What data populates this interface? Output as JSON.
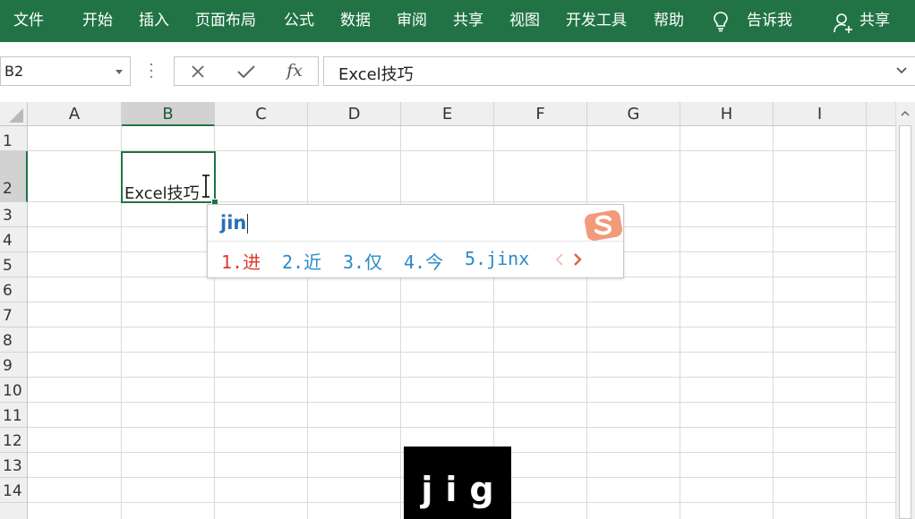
{
  "ribbon": {
    "tabs": [
      {
        "id": "file",
        "label": "文件"
      },
      {
        "id": "home",
        "label": "开始"
      },
      {
        "id": "insert",
        "label": "插入"
      },
      {
        "id": "page-layout",
        "label": "页面布局"
      },
      {
        "id": "formulas",
        "label": "公式"
      },
      {
        "id": "data",
        "label": "数据"
      },
      {
        "id": "review",
        "label": "审阅"
      },
      {
        "id": "share-tab",
        "label": "共享"
      },
      {
        "id": "view",
        "label": "视图"
      },
      {
        "id": "developer",
        "label": "开发工具"
      },
      {
        "id": "help",
        "label": "帮助"
      }
    ],
    "tell_me": "告诉我",
    "share": "共享",
    "background": "#217346"
  },
  "formula_bar": {
    "name_box": "B2",
    "cancel_icon": "x-icon",
    "enter_icon": "check-icon",
    "fx_label": "fx",
    "formula_value": "Excel技巧"
  },
  "grid": {
    "columns": [
      "A",
      "B",
      "C",
      "D",
      "E",
      "F",
      "G",
      "H",
      "I"
    ],
    "rows": [
      "1",
      "2",
      "3",
      "4",
      "5",
      "6",
      "7",
      "8",
      "9",
      "10",
      "11",
      "12",
      "13",
      "14"
    ],
    "selected_column": "B",
    "selected_row": "2",
    "active_cell_text": "Excel技巧",
    "accent": "#217346"
  },
  "ime": {
    "composition": "jin",
    "candidates": [
      "1.进",
      "2.近",
      "3.仅",
      "4.今",
      "5.jinx"
    ],
    "first_color": "#e0392b",
    "candidate_color": "#2a8ac8"
  },
  "key_overlay": {
    "text": "jig"
  }
}
